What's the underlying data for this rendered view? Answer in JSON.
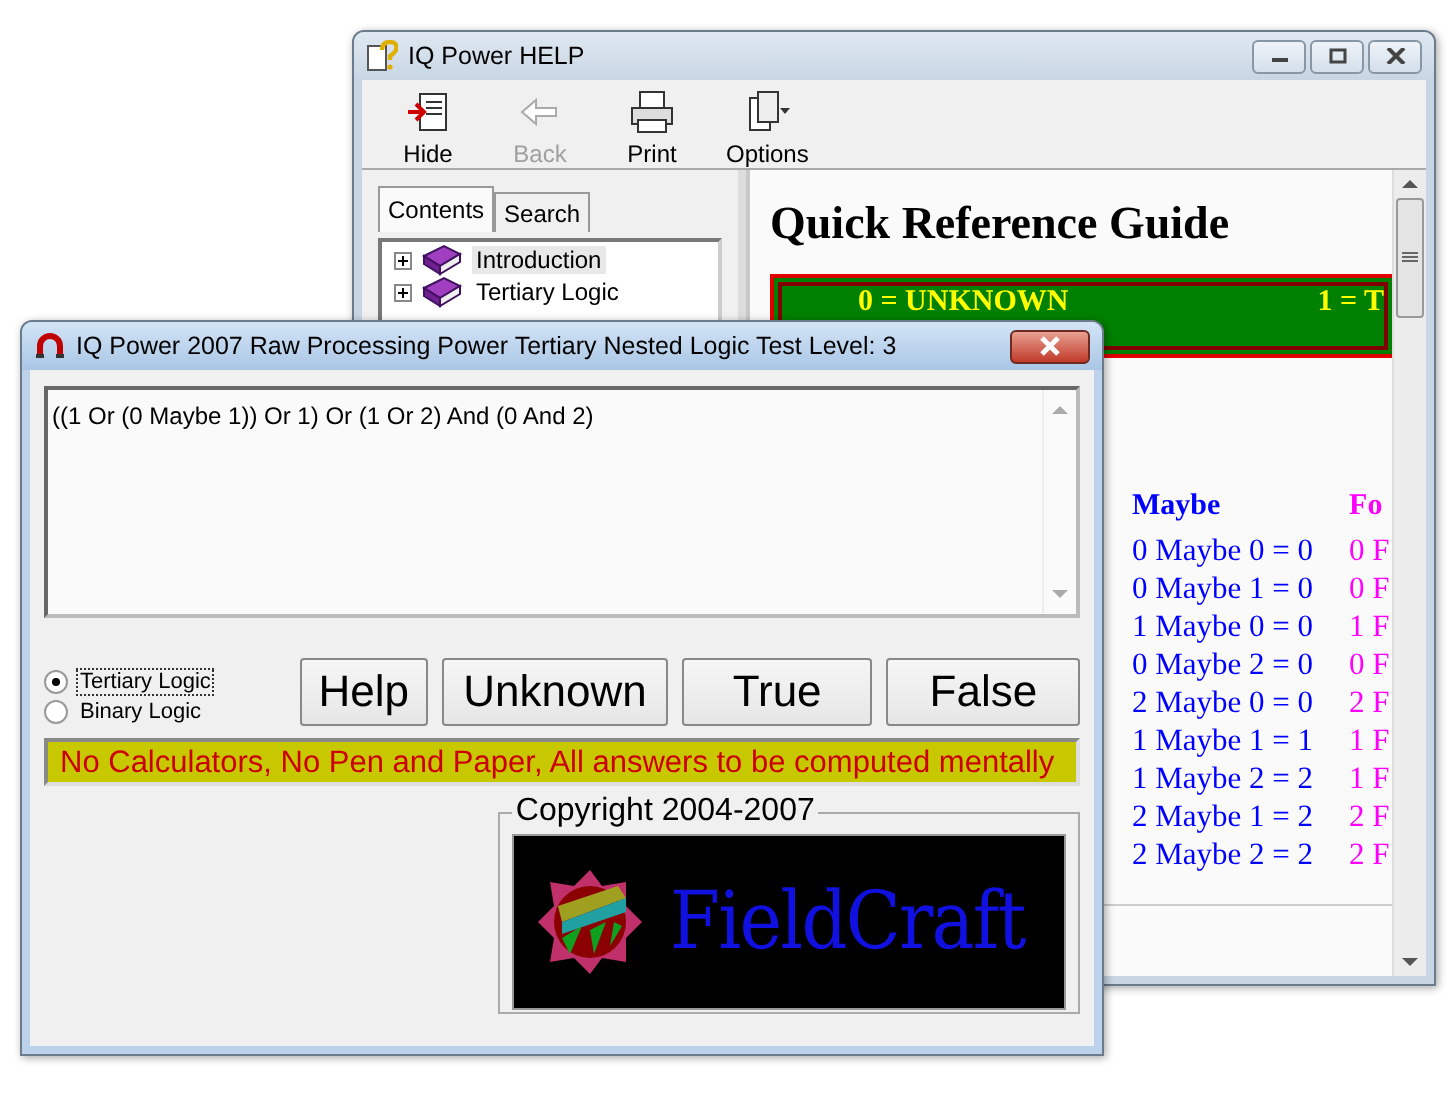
{
  "help_window": {
    "title": "IQ Power HELP",
    "toolbar": [
      {
        "kind": "hide",
        "label": "Hide",
        "disabled": false
      },
      {
        "kind": "back",
        "label": "Back",
        "disabled": true
      },
      {
        "kind": "print",
        "label": "Print",
        "disabled": false
      },
      {
        "kind": "options",
        "label": "Options",
        "disabled": false
      }
    ],
    "tabs": [
      {
        "label": "Contents",
        "selected": true
      },
      {
        "label": "Search",
        "selected": false
      }
    ],
    "tree": [
      {
        "label": "Introduction",
        "selected": true
      },
      {
        "label": "Tertiary Logic",
        "selected": false
      }
    ],
    "content": {
      "heading": "Quick Reference Guide",
      "legend": [
        "0 = UNKNOWN",
        "1 = T"
      ],
      "columns": [
        {
          "heading": "Maybe",
          "color": "#0000ff",
          "rows": [
            "0 Maybe 0 = 0",
            "0 Maybe 1 = 0",
            "1 Maybe 0 = 0",
            "0 Maybe 2 = 0",
            "2 Maybe 0 = 0",
            "1 Maybe 1 = 1",
            "1 Maybe 2 = 2",
            "2 Maybe 1 = 2",
            "2 Maybe 2 = 2"
          ]
        },
        {
          "heading": "Fo",
          "color": "#ff00ff",
          "rows": [
            "0 F",
            "0 F",
            "1 F",
            "0 F",
            "2 F",
            "1 F",
            "1 F",
            "2 F",
            "2 F"
          ]
        }
      ]
    }
  },
  "test_window": {
    "title": "IQ Power 2007 Raw Processing Power Tertiary Nested Logic Test Level: 3",
    "expression": "((1 Or (0 Maybe 1)) Or 1) Or (1 Or 2) And (0 And 2)",
    "modes": [
      {
        "label": "Tertiary Logic",
        "selected": true
      },
      {
        "label": "Binary Logic",
        "selected": false
      }
    ],
    "buttons": [
      "Help",
      "Unknown",
      "True",
      "False"
    ],
    "notice": "No Calculators, No Pen and Paper, All answers to be computed mentally",
    "copyright": "Copyright 2004-2007",
    "logo": "FieldCraft"
  }
}
